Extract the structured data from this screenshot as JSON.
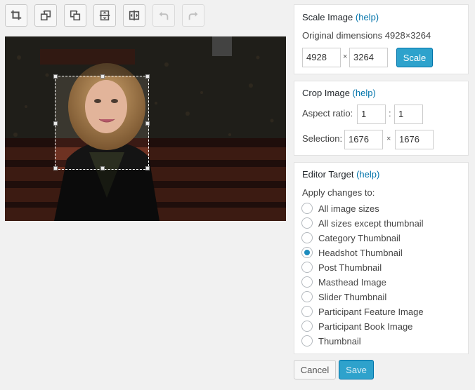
{
  "toolbar": [
    {
      "name": "crop-icon",
      "disabled": false
    },
    {
      "name": "rotate-left-icon",
      "disabled": false
    },
    {
      "name": "rotate-right-icon",
      "disabled": false
    },
    {
      "name": "flip-vertical-icon",
      "disabled": false
    },
    {
      "name": "flip-horizontal-icon",
      "disabled": false
    },
    {
      "name": "undo-icon",
      "disabled": true
    },
    {
      "name": "redo-icon",
      "disabled": true
    }
  ],
  "scale": {
    "title": "Scale Image",
    "help": "(help)",
    "original_label": "Original dimensions 4928×3264",
    "width": "4928",
    "times": "×",
    "height": "3264",
    "button": "Scale"
  },
  "crop": {
    "title": "Crop Image",
    "help": "(help)",
    "aspect_label": "Aspect ratio:",
    "aspect_w": "1",
    "colon": ":",
    "aspect_h": "1",
    "selection_label": "Selection:",
    "sel_w": "1676",
    "times": "×",
    "sel_h": "1676"
  },
  "target": {
    "title": "Editor Target",
    "help": "(help)",
    "apply_label": "Apply changes to:",
    "options": [
      {
        "label": "All image sizes",
        "selected": false
      },
      {
        "label": "All sizes except thumbnail",
        "selected": false
      },
      {
        "label": "Category Thumbnail",
        "selected": false
      },
      {
        "label": "Headshot Thumbnail",
        "selected": true
      },
      {
        "label": "Post Thumbnail",
        "selected": false
      },
      {
        "label": "Masthead Image",
        "selected": false
      },
      {
        "label": "Slider Thumbnail",
        "selected": false
      },
      {
        "label": "Participant Feature Image",
        "selected": false
      },
      {
        "label": "Participant Book Image",
        "selected": false
      },
      {
        "label": "Thumbnail",
        "selected": false
      }
    ]
  },
  "actions": {
    "cancel": "Cancel",
    "save": "Save"
  },
  "colors": {
    "primary": "#2ea2cc",
    "link": "#0073aa",
    "selected_radio": "#1e8cbe"
  }
}
